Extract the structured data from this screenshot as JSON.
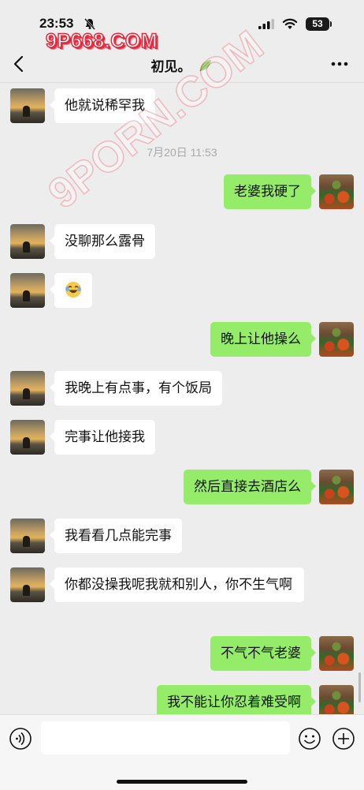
{
  "status_bar": {
    "time": "23:53",
    "battery": "53"
  },
  "watermarks": {
    "top": "9P668.COM",
    "diagonal": "9PORN.COM"
  },
  "nav": {
    "title": "初见。"
  },
  "timestamp": "7月20日 11:53",
  "messages": [
    {
      "side": "other",
      "text": "他就说稀罕我"
    },
    {
      "side": "self",
      "text": "老婆我硬了"
    },
    {
      "side": "other",
      "text": "没聊那么露骨"
    },
    {
      "side": "other",
      "text": "",
      "sticker": "laughing-crying-emoji"
    },
    {
      "side": "self",
      "text": "晚上让他操么"
    },
    {
      "side": "other",
      "text": "我晚上有点事，有个饭局"
    },
    {
      "side": "other",
      "text": "完事让他接我"
    },
    {
      "side": "self",
      "text": "然后直接去酒店么"
    },
    {
      "side": "other",
      "text": "我看看几点能完事"
    },
    {
      "side": "other",
      "text": "你都没操我呢我就和别人，你不生气啊"
    },
    {
      "side": "self",
      "text": "不气不气老婆"
    },
    {
      "side": "self",
      "text": "我不能让你忍着难受啊"
    }
  ],
  "input": {
    "value": "",
    "placeholder": ""
  },
  "colors": {
    "background": "#ededed",
    "self_bubble": "#95ec69",
    "other_bubble": "#ffffff",
    "watermark": "#e8283c"
  },
  "icons": [
    "back-icon",
    "leaf-icon",
    "more-icon",
    "voice-icon",
    "emoji-icon",
    "plus-icon"
  ]
}
